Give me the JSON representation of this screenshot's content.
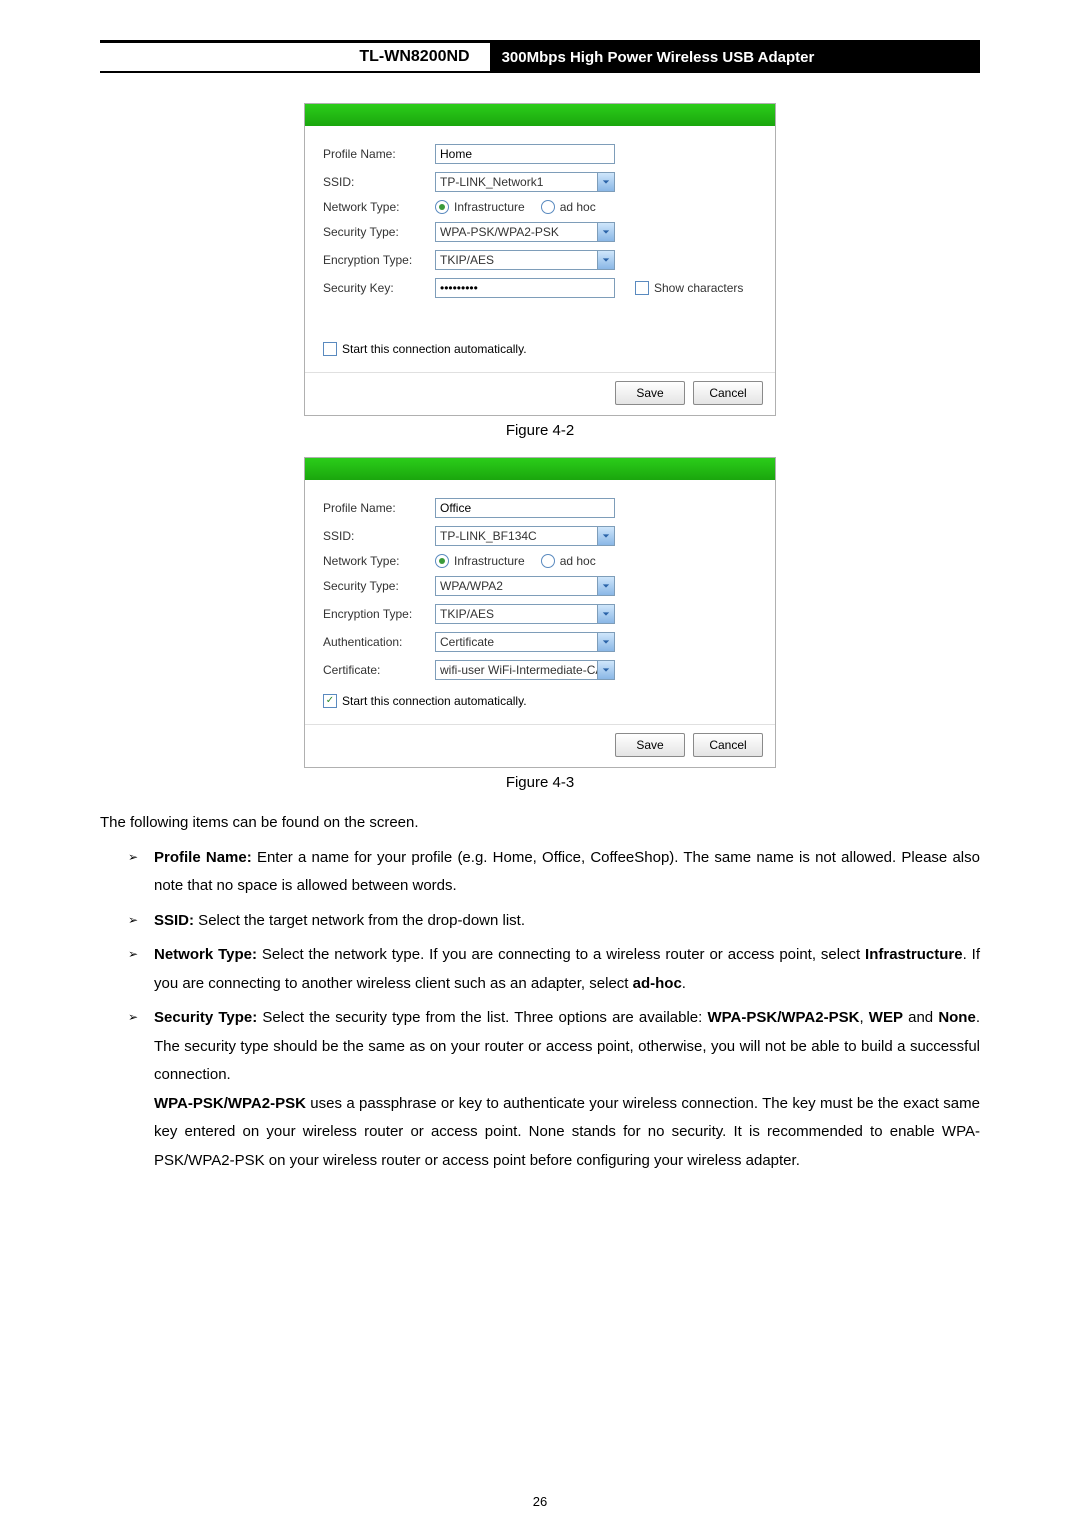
{
  "header": {
    "model": "TL-WN8200ND",
    "title": "300Mbps High Power Wireless USB Adapter"
  },
  "dialog1": {
    "labels": {
      "profileName": "Profile Name:",
      "ssid": "SSID:",
      "networkType": "Network Type:",
      "securityType": "Security Type:",
      "encryptionType": "Encryption Type:",
      "securityKey": "Security Key:"
    },
    "values": {
      "profileName": "Home",
      "ssid": "TP-LINK_Network1",
      "infrastructure": "Infrastructure",
      "adhoc": "ad hoc",
      "securityType": "WPA-PSK/WPA2-PSK",
      "encryptionType": "TKIP/AES",
      "securityKey": "•••••••••"
    },
    "showChars": "Show characters",
    "autoStart": "Start this connection automatically.",
    "save": "Save",
    "cancel": "Cancel"
  },
  "caption1": "Figure 4-2",
  "dialog2": {
    "labels": {
      "profileName": "Profile Name:",
      "ssid": "SSID:",
      "networkType": "Network Type:",
      "securityType": "Security Type:",
      "encryptionType": "Encryption Type:",
      "authentication": "Authentication:",
      "certificate": "Certificate:"
    },
    "values": {
      "profileName": "Office",
      "ssid": "TP-LINK_BF134C",
      "infrastructure": "Infrastructure",
      "adhoc": "ad hoc",
      "securityType": "WPA/WPA2",
      "encryptionType": "TKIP/AES",
      "authentication": "Certificate",
      "certificate": "wifi-user WiFi-Intermediate-CA-:"
    },
    "autoStart": "Start this connection automatically.",
    "save": "Save",
    "cancel": "Cancel"
  },
  "caption2": "Figure 4-3",
  "text": {
    "intro": "The following items can be found on the screen.",
    "b1a": "Profile Name:",
    "b1b": " Enter a name for your profile (e.g. Home, Office, CoffeeShop). The same name is not allowed. Please also note that no space is allowed between words.",
    "b2a": "SSID:",
    "b2b": " Select the target network from the drop-down list.",
    "b3a": "Network Type:",
    "b3b": " Select the network type. If you are connecting to a wireless router or access point, select ",
    "b3c": "Infrastructure",
    "b3d": ". If you are connecting to another wireless client such as an adapter, select ",
    "b3e": "ad-hoc",
    "b3f": ".",
    "b4a": "Security Type:",
    "b4b": " Select the security type from the list. Three options are available: ",
    "b4c": "WPA-PSK/WPA2-PSK",
    "b4d": ", ",
    "b4e": "WEP",
    "b4f": " and ",
    "b4g": "None",
    "b4h": ". The security type should be the same as on your router or access point, otherwise, you will not be able to build a successful connection.",
    "b4i": "WPA-PSK/WPA2-PSK",
    "b4j": " uses a passphrase or key to authenticate your wireless connection. The key must be the exact same key entered on your wireless router or access point. None stands for no security. It is recommended to enable WPA-PSK/WPA2-PSK on your wireless router or access point before configuring your wireless adapter."
  },
  "pageNumber": "26"
}
